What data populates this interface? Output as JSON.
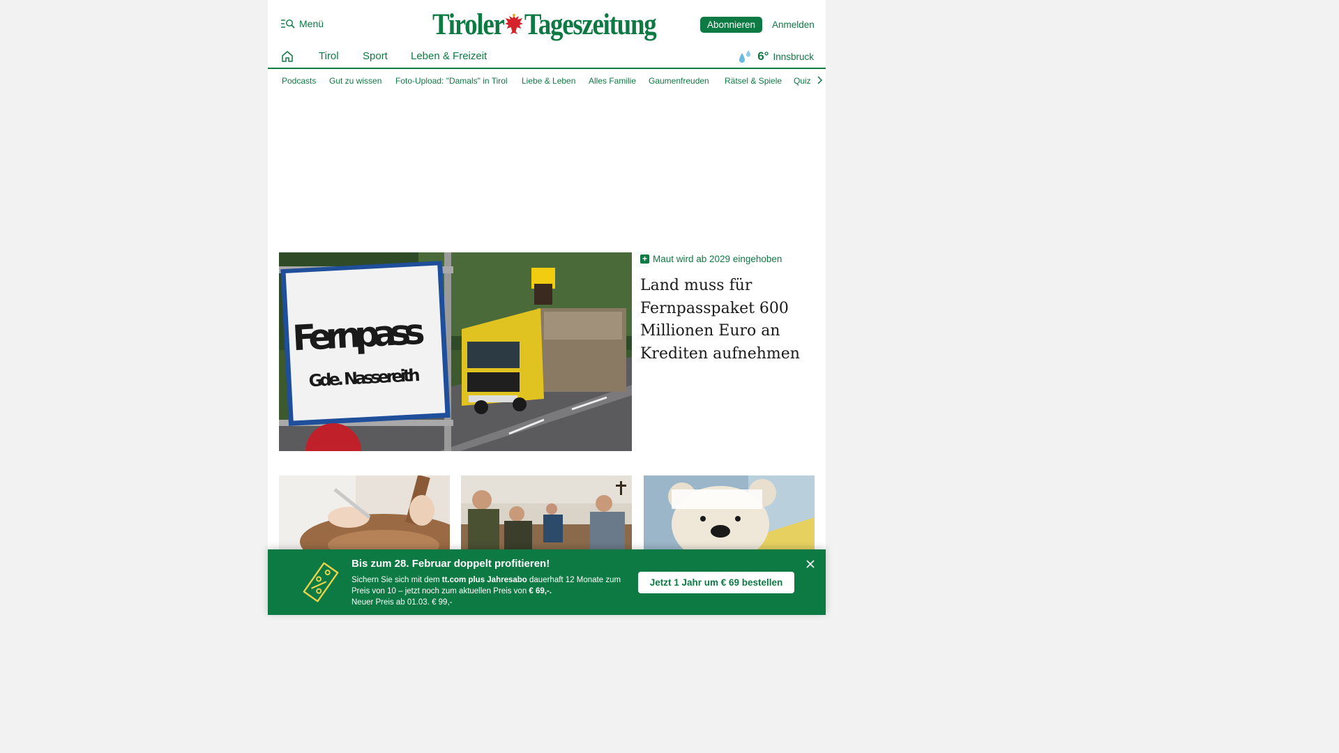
{
  "header": {
    "menu_label": "Menü",
    "logo_left": "Tiroler",
    "logo_right": "Tageszeitung",
    "subscribe_label": "Abonnieren",
    "login_label": "Anmelden"
  },
  "nav": {
    "items": [
      "Tirol",
      "Sport",
      "Leben & Freizeit"
    ],
    "weather": {
      "temp": "6°",
      "city": "Innsbruck"
    }
  },
  "subnav": {
    "items": [
      "Podcasts",
      "Gut zu wissen",
      "Foto-Upload: \"Damals\" in Tirol",
      "Liebe & Leben",
      "Alles Familie",
      "Gaumenfreuden",
      "Rätsel & Spiele",
      "Quiz"
    ]
  },
  "lead": {
    "kicker": "Maut wird ab 2029 eingehoben",
    "title": "Land muss für Fernpasspaket 600 Millionen Euro an Krediten aufnehmen",
    "image": {
      "sign_line1": "Fernpass",
      "sign_line2": "Gde. Nassereith"
    }
  },
  "promo": {
    "title": "Bis zum 28. Februar doppelt profitieren!",
    "text_1": "Sichern Sie sich mit dem ",
    "text_bold_1": "tt.com plus Jahresabo",
    "text_2": " dauerhaft 12 Monate zum Preis von 10 – jetzt noch zum aktuellen Preis von ",
    "text_bold_2": "€ 69,-.",
    "text_3": "Neuer Preis ab 01.03. € 99,-",
    "cta_label": "Jetzt 1 Jahr um € 69 bestellen"
  },
  "colors": {
    "brand_green": "#0e7a43",
    "page_bg": "#f2f2f2"
  }
}
